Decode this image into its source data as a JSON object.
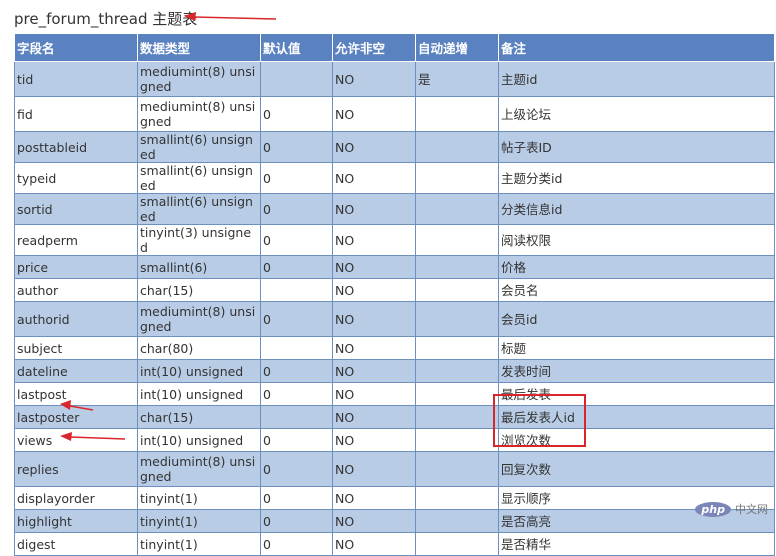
{
  "title": {
    "table_name": "pre_forum_thread",
    "label": "主题表"
  },
  "columns": [
    "字段名",
    "数据类型",
    "默认值",
    "允许非空",
    "自动递增",
    "备注"
  ],
  "rows": [
    {
      "name": "tid",
      "type": "mediumint(8) unsigned",
      "default": "",
      "nullable": "NO",
      "auto": "是",
      "note": "主题id"
    },
    {
      "name": "fid",
      "type": "mediumint(8) unsigned",
      "default": "0",
      "nullable": "NO",
      "auto": "",
      "note": "上级论坛"
    },
    {
      "name": "posttableid",
      "type": "smallint(6) unsigned",
      "default": "0",
      "nullable": "NO",
      "auto": "",
      "note": "帖子表ID"
    },
    {
      "name": "typeid",
      "type": "smallint(6) unsigned",
      "default": "0",
      "nullable": "NO",
      "auto": "",
      "note": "主题分类id"
    },
    {
      "name": "sortid",
      "type": "smallint(6) unsigned",
      "default": "0",
      "nullable": "NO",
      "auto": "",
      "note": "分类信息id"
    },
    {
      "name": "readperm",
      "type": "tinyint(3) unsigned",
      "default": "0",
      "nullable": "NO",
      "auto": "",
      "note": "阅读权限"
    },
    {
      "name": "price",
      "type": "smallint(6)",
      "default": "0",
      "nullable": "NO",
      "auto": "",
      "note": "价格"
    },
    {
      "name": "author",
      "type": "char(15)",
      "default": "",
      "nullable": "NO",
      "auto": "",
      "note": "会员名"
    },
    {
      "name": "authorid",
      "type": "mediumint(8) unsigned",
      "default": "0",
      "nullable": "NO",
      "auto": "",
      "note": "会员id"
    },
    {
      "name": "subject",
      "type": "char(80)",
      "default": "",
      "nullable": "NO",
      "auto": "",
      "note": "标题"
    },
    {
      "name": "dateline",
      "type": "int(10) unsigned",
      "default": "0",
      "nullable": "NO",
      "auto": "",
      "note": "发表时间"
    },
    {
      "name": "lastpost",
      "type": "int(10) unsigned",
      "default": "0",
      "nullable": "NO",
      "auto": "",
      "note": "最后发表"
    },
    {
      "name": "lastposter",
      "type": "char(15)",
      "default": "",
      "nullable": "NO",
      "auto": "",
      "note": "最后发表人id"
    },
    {
      "name": "views",
      "type": "int(10) unsigned",
      "default": "0",
      "nullable": "NO",
      "auto": "",
      "note": "浏览次数"
    },
    {
      "name": "replies",
      "type": "mediumint(8) unsigned",
      "default": "0",
      "nullable": "NO",
      "auto": "",
      "note": "回复次数"
    },
    {
      "name": "displayorder",
      "type": "tinyint(1)",
      "default": "0",
      "nullable": "NO",
      "auto": "",
      "note": "显示顺序"
    },
    {
      "name": "highlight",
      "type": "tinyint(1)",
      "default": "0",
      "nullable": "NO",
      "auto": "",
      "note": "是否高亮"
    },
    {
      "name": "digest",
      "type": "tinyint(1)",
      "default": "0",
      "nullable": "NO",
      "auto": "",
      "note": "是否精华"
    }
  ],
  "watermark": {
    "logo": "php",
    "text": "中文网"
  },
  "colors": {
    "header_bg": "#5b82c0",
    "row_alt_bg": "#b9cce6",
    "annotation_red": "#d9262b"
  }
}
